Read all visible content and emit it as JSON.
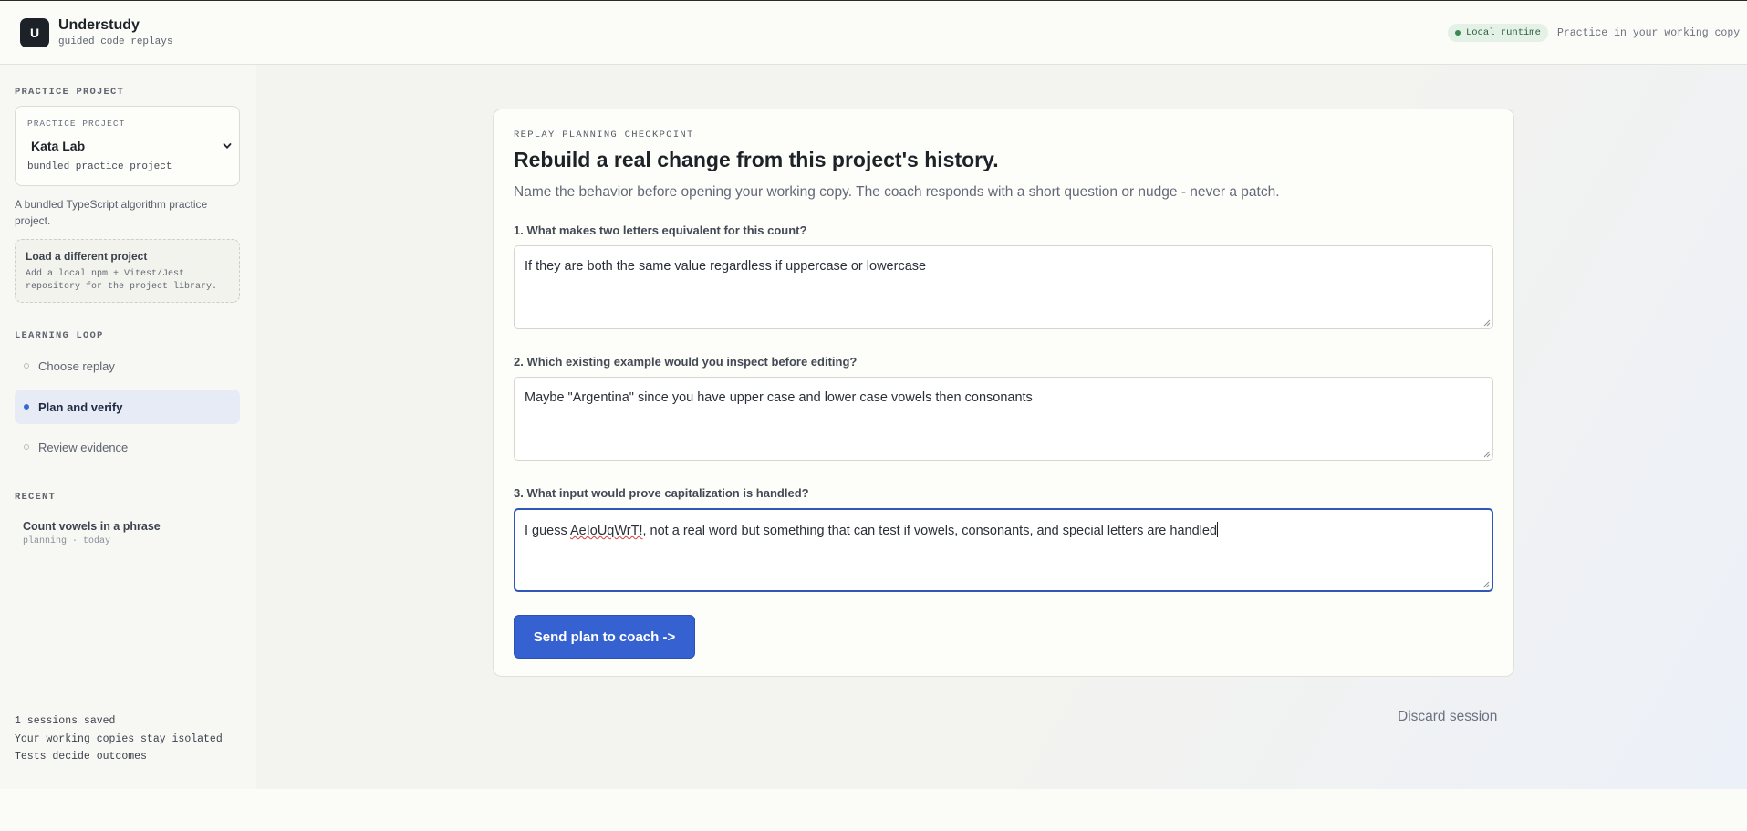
{
  "header": {
    "logo_letter": "U",
    "app_name": "Understudy",
    "tagline": "guided code replays",
    "runtime_badge": "Local runtime",
    "right_text": "Practice in your working copy"
  },
  "sidebar": {
    "practice_section": "PRACTICE PROJECT",
    "project_card": {
      "label": "PRACTICE PROJECT",
      "name": "Kata Lab",
      "subtitle": "bundled practice project"
    },
    "project_description": "A bundled TypeScript algorithm practice project.",
    "load_card": {
      "title": "Load a different project",
      "subtitle": "Add a local npm + Vitest/Jest repository for the project library."
    },
    "learning_section": "LEARNING LOOP",
    "loop_items": [
      {
        "label": "Choose replay",
        "active": false
      },
      {
        "label": "Plan and verify",
        "active": true
      },
      {
        "label": "Review evidence",
        "active": false
      }
    ],
    "recent_section": "RECENT",
    "recent_item": {
      "title": "Count vowels in a phrase",
      "meta": "planning · today"
    },
    "footer": {
      "sessions": "1 sessions saved",
      "isolation": "Your working copies stay isolated",
      "tests": "Tests decide outcomes"
    }
  },
  "main": {
    "eyebrow": "REPLAY PLANNING CHECKPOINT",
    "title": "Rebuild a real change from this project's history.",
    "subtitle": "Name the behavior before opening your working copy. The coach responds with a short question or nudge - never a patch.",
    "questions": [
      {
        "label": "1. What makes two letters equivalent for this count?",
        "answer": "If they are both the same value regardless if uppercase or lowercase"
      },
      {
        "label": "2. Which existing example would you inspect before editing?",
        "answer": "Maybe \"Argentina\" since you have upper case and lower case vowels then consonants"
      },
      {
        "label": "3. What input would prove capitalization is handled?",
        "answer_prefix": "I guess ",
        "answer_flagged": "AeIoUqWrT!",
        "answer_suffix": ", not a real word but something that can test if vowels, consonants, and special letters are handled"
      }
    ],
    "send_button": "Send plan to coach ->",
    "discard_link": "Discard session"
  },
  "colors": {
    "accent": "#3561d1",
    "runtime_badge_bg": "#e3f1e6",
    "active_nav_bg": "#e6ebf6"
  }
}
